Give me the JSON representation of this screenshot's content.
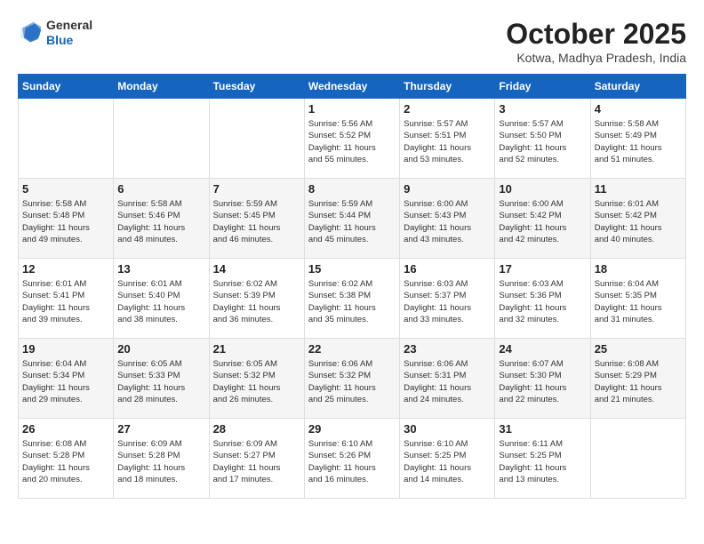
{
  "logo": {
    "general": "General",
    "blue": "Blue"
  },
  "title": "October 2025",
  "subtitle": "Kotwa, Madhya Pradesh, India",
  "weekdays": [
    "Sunday",
    "Monday",
    "Tuesday",
    "Wednesday",
    "Thursday",
    "Friday",
    "Saturday"
  ],
  "weeks": [
    [
      {
        "day": "",
        "info": ""
      },
      {
        "day": "",
        "info": ""
      },
      {
        "day": "",
        "info": ""
      },
      {
        "day": "1",
        "info": "Sunrise: 5:56 AM\nSunset: 5:52 PM\nDaylight: 11 hours\nand 55 minutes."
      },
      {
        "day": "2",
        "info": "Sunrise: 5:57 AM\nSunset: 5:51 PM\nDaylight: 11 hours\nand 53 minutes."
      },
      {
        "day": "3",
        "info": "Sunrise: 5:57 AM\nSunset: 5:50 PM\nDaylight: 11 hours\nand 52 minutes."
      },
      {
        "day": "4",
        "info": "Sunrise: 5:58 AM\nSunset: 5:49 PM\nDaylight: 11 hours\nand 51 minutes."
      }
    ],
    [
      {
        "day": "5",
        "info": "Sunrise: 5:58 AM\nSunset: 5:48 PM\nDaylight: 11 hours\nand 49 minutes."
      },
      {
        "day": "6",
        "info": "Sunrise: 5:58 AM\nSunset: 5:46 PM\nDaylight: 11 hours\nand 48 minutes."
      },
      {
        "day": "7",
        "info": "Sunrise: 5:59 AM\nSunset: 5:45 PM\nDaylight: 11 hours\nand 46 minutes."
      },
      {
        "day": "8",
        "info": "Sunrise: 5:59 AM\nSunset: 5:44 PM\nDaylight: 11 hours\nand 45 minutes."
      },
      {
        "day": "9",
        "info": "Sunrise: 6:00 AM\nSunset: 5:43 PM\nDaylight: 11 hours\nand 43 minutes."
      },
      {
        "day": "10",
        "info": "Sunrise: 6:00 AM\nSunset: 5:42 PM\nDaylight: 11 hours\nand 42 minutes."
      },
      {
        "day": "11",
        "info": "Sunrise: 6:01 AM\nSunset: 5:42 PM\nDaylight: 11 hours\nand 40 minutes."
      }
    ],
    [
      {
        "day": "12",
        "info": "Sunrise: 6:01 AM\nSunset: 5:41 PM\nDaylight: 11 hours\nand 39 minutes."
      },
      {
        "day": "13",
        "info": "Sunrise: 6:01 AM\nSunset: 5:40 PM\nDaylight: 11 hours\nand 38 minutes."
      },
      {
        "day": "14",
        "info": "Sunrise: 6:02 AM\nSunset: 5:39 PM\nDaylight: 11 hours\nand 36 minutes."
      },
      {
        "day": "15",
        "info": "Sunrise: 6:02 AM\nSunset: 5:38 PM\nDaylight: 11 hours\nand 35 minutes."
      },
      {
        "day": "16",
        "info": "Sunrise: 6:03 AM\nSunset: 5:37 PM\nDaylight: 11 hours\nand 33 minutes."
      },
      {
        "day": "17",
        "info": "Sunrise: 6:03 AM\nSunset: 5:36 PM\nDaylight: 11 hours\nand 32 minutes."
      },
      {
        "day": "18",
        "info": "Sunrise: 6:04 AM\nSunset: 5:35 PM\nDaylight: 11 hours\nand 31 minutes."
      }
    ],
    [
      {
        "day": "19",
        "info": "Sunrise: 6:04 AM\nSunset: 5:34 PM\nDaylight: 11 hours\nand 29 minutes."
      },
      {
        "day": "20",
        "info": "Sunrise: 6:05 AM\nSunset: 5:33 PM\nDaylight: 11 hours\nand 28 minutes."
      },
      {
        "day": "21",
        "info": "Sunrise: 6:05 AM\nSunset: 5:32 PM\nDaylight: 11 hours\nand 26 minutes."
      },
      {
        "day": "22",
        "info": "Sunrise: 6:06 AM\nSunset: 5:32 PM\nDaylight: 11 hours\nand 25 minutes."
      },
      {
        "day": "23",
        "info": "Sunrise: 6:06 AM\nSunset: 5:31 PM\nDaylight: 11 hours\nand 24 minutes."
      },
      {
        "day": "24",
        "info": "Sunrise: 6:07 AM\nSunset: 5:30 PM\nDaylight: 11 hours\nand 22 minutes."
      },
      {
        "day": "25",
        "info": "Sunrise: 6:08 AM\nSunset: 5:29 PM\nDaylight: 11 hours\nand 21 minutes."
      }
    ],
    [
      {
        "day": "26",
        "info": "Sunrise: 6:08 AM\nSunset: 5:28 PM\nDaylight: 11 hours\nand 20 minutes."
      },
      {
        "day": "27",
        "info": "Sunrise: 6:09 AM\nSunset: 5:28 PM\nDaylight: 11 hours\nand 18 minutes."
      },
      {
        "day": "28",
        "info": "Sunrise: 6:09 AM\nSunset: 5:27 PM\nDaylight: 11 hours\nand 17 minutes."
      },
      {
        "day": "29",
        "info": "Sunrise: 6:10 AM\nSunset: 5:26 PM\nDaylight: 11 hours\nand 16 minutes."
      },
      {
        "day": "30",
        "info": "Sunrise: 6:10 AM\nSunset: 5:25 PM\nDaylight: 11 hours\nand 14 minutes."
      },
      {
        "day": "31",
        "info": "Sunrise: 6:11 AM\nSunset: 5:25 PM\nDaylight: 11 hours\nand 13 minutes."
      },
      {
        "day": "",
        "info": ""
      }
    ]
  ]
}
